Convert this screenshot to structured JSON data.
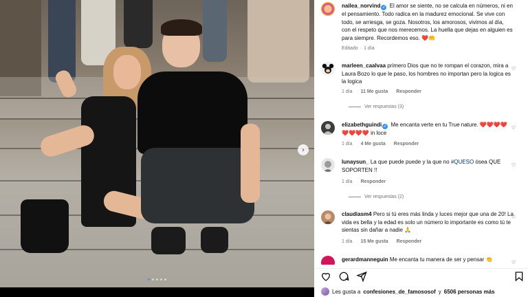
{
  "post": {
    "author": "nailea_norvind",
    "caption": "El amor se siente, no se calcula en números, ni en el pensamiento. Todo radica en la madurez emocional. Se vive con todo, se arriesga, se goza. Nosotros, los amorosos, vivimos al día, con el respeto que nos merecemos. La huella que dejas en alguien es para siempre. Recordemos eso. ❤️🤲",
    "edited": "Editado",
    "separator": "·",
    "age": "1 día"
  },
  "comments": [
    {
      "user": "marleen_caalvaa",
      "text": "primero Dios que no te rompan el corazon, mira a Laura Bozo lo que le paso, los hombres no importan pero la logica es la logica",
      "age": "1 día",
      "likes": "11 Me gusta",
      "reply": "Responder",
      "view_replies": "Ver respuestas (3)"
    },
    {
      "user": "elizabethguindi",
      "text_before": "Me encanta verte en tu True nature.",
      "hearts": "❤️❤️❤️❤️❤️❤️❤️❤️",
      "text_after": "in loce",
      "age": "1 día",
      "likes": "4 Me gusta",
      "reply": "Responder"
    },
    {
      "user": "lunaysun_",
      "text_before": "La que puede puede y la que no",
      "hashtag": "#QUESO",
      "text_after": "ósea QUE SOPORTEN !!",
      "age": "1 día",
      "reply": "Responder",
      "view_replies": "Ver respuestas (2)"
    },
    {
      "user": "claudiasm4",
      "text": "Pero si tú eres más linda y luces mejor que una de 20! La vida es bella y la edad es solo un número lo importante es como tú te sientas sin dañar a nadie 🙏",
      "age": "1 día",
      "likes": "15 Me gusta",
      "reply": "Responder"
    },
    {
      "user": "gerardmanneguin",
      "text": "Me encanta tu manera de ser y pensar 👏"
    }
  ],
  "likes_line": {
    "prefix": "Les gusta a",
    "user": "confesiones_de_famososof",
    "middle": "y",
    "count": "6506 personas más"
  },
  "icons": {
    "like": "heart-icon",
    "comment": "comment-icon",
    "share": "share-icon",
    "save": "bookmark-icon",
    "next": "chevron-right-icon"
  },
  "colors": {
    "verified": "#3897f0",
    "link": "#00376b",
    "meta": "#737373",
    "carousel_active": "#4a90e2"
  }
}
